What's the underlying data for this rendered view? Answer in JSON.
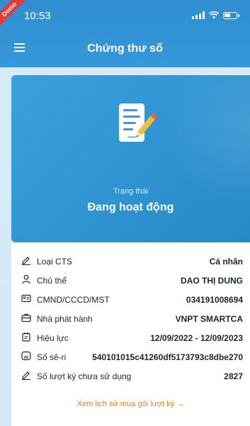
{
  "status_bar": {
    "time": "10:53"
  },
  "demo_badge": "Demo",
  "header": {
    "title": "Chứng thư số"
  },
  "card": {
    "status_label": "Trạng thái",
    "status_value": "Đang hoạt động"
  },
  "details": {
    "rows": [
      {
        "label": "Loại CTS",
        "value": "Cá nhân",
        "icon": "pen-icon"
      },
      {
        "label": "Chủ thể",
        "value": "DAO THỊ DUNG",
        "icon": "user-icon"
      },
      {
        "label": "CMND/CCCD/MST",
        "value": "034191008694",
        "icon": "id-card-icon"
      },
      {
        "label": "Nhà phát hành",
        "value": "VNPT SMARTCA",
        "icon": "briefcase-icon"
      },
      {
        "label": "Hiệu lực",
        "value": "12/09/2022 - 12/09/2023",
        "icon": "calendar-icon"
      },
      {
        "label": "Số sê-ri",
        "value": "540101015c41260df5173793c8dbe270",
        "icon": "serial-icon"
      },
      {
        "label": "Số lượt ký chưa sử dụng",
        "value": "2827",
        "icon": "pen-icon"
      }
    ]
  },
  "link": {
    "label": "Xem lịch sử mua gói lượt ký →"
  },
  "colors": {
    "primary": "#2f8fd0",
    "link": "#ee7d10"
  }
}
